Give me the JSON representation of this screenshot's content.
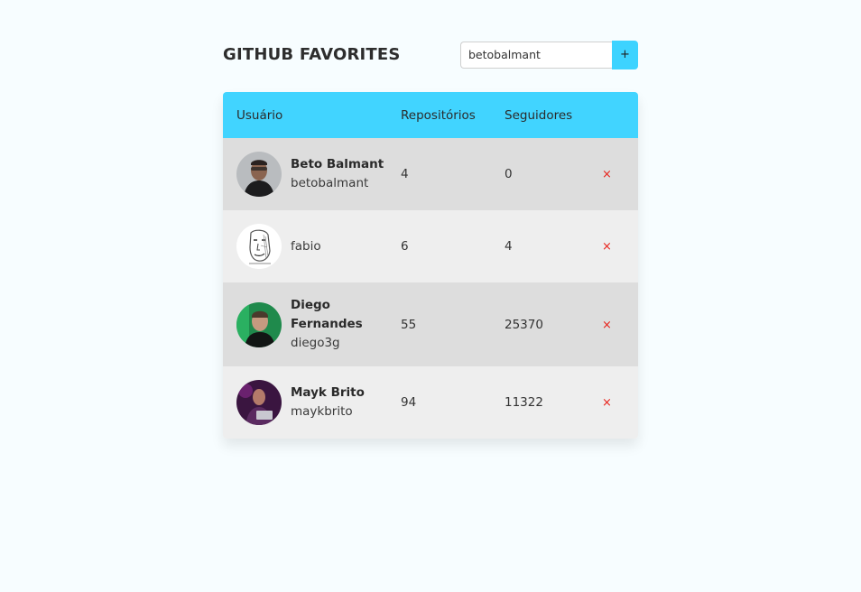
{
  "header": {
    "title": "GITHUB FAVORITES"
  },
  "search": {
    "value": "betobalmant",
    "add_label": "+"
  },
  "table": {
    "columns": [
      "Usuário",
      "Repositórios",
      "Seguidores"
    ],
    "rows": [
      {
        "name": "Beto Balmant",
        "login": "betobalmant",
        "repositories": "4",
        "followers": "0",
        "remove_label": "×",
        "avatar_icon": "person-photo-icon"
      },
      {
        "name": "",
        "login": "fabio",
        "repositories": "6",
        "followers": "4",
        "remove_label": "×",
        "avatar_icon": "sketch-portrait-icon"
      },
      {
        "name": "Diego Fernandes",
        "login": "diego3g",
        "repositories": "55",
        "followers": "25370",
        "remove_label": "×",
        "avatar_icon": "person-photo-icon"
      },
      {
        "name": "Mayk Brito",
        "login": "maykbrito",
        "repositories": "94",
        "followers": "11322",
        "remove_label": "×",
        "avatar_icon": "person-photo-icon"
      }
    ]
  },
  "colors": {
    "accent": "#41d4ff",
    "row_dark": "#dddddd",
    "row_light": "#eeeeee",
    "remove": "#e8231c",
    "background": "#f7fdff"
  }
}
